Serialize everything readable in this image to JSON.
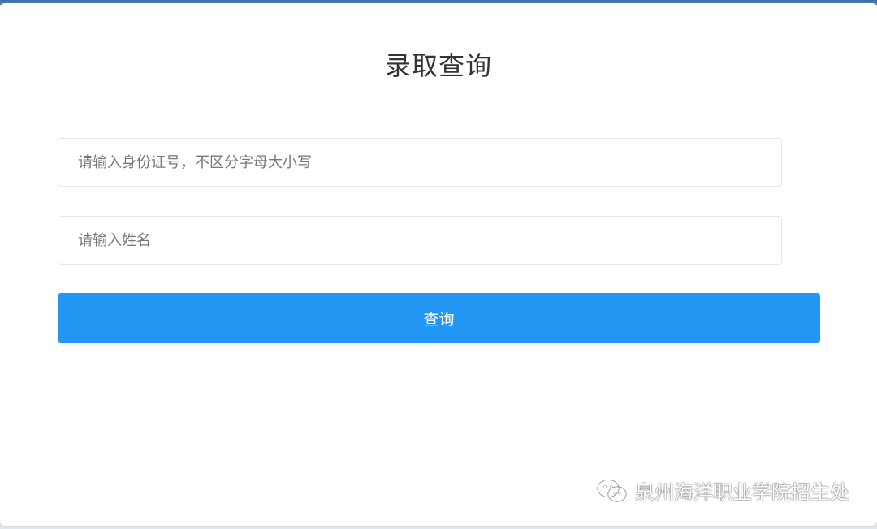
{
  "page": {
    "title": "录取查询"
  },
  "form": {
    "id_placeholder": "请输入身份证号，不区分字母大小写",
    "id_value": "",
    "name_placeholder": "请输入姓名",
    "name_value": "",
    "submit_label": "查询"
  },
  "watermark": {
    "text": "泉州海洋职业学院招生处",
    "icon": "wechat-icon"
  },
  "colors": {
    "accent": "#2196f3",
    "title_text": "#333333",
    "placeholder": "#777777",
    "border": "#e6e6e6"
  }
}
